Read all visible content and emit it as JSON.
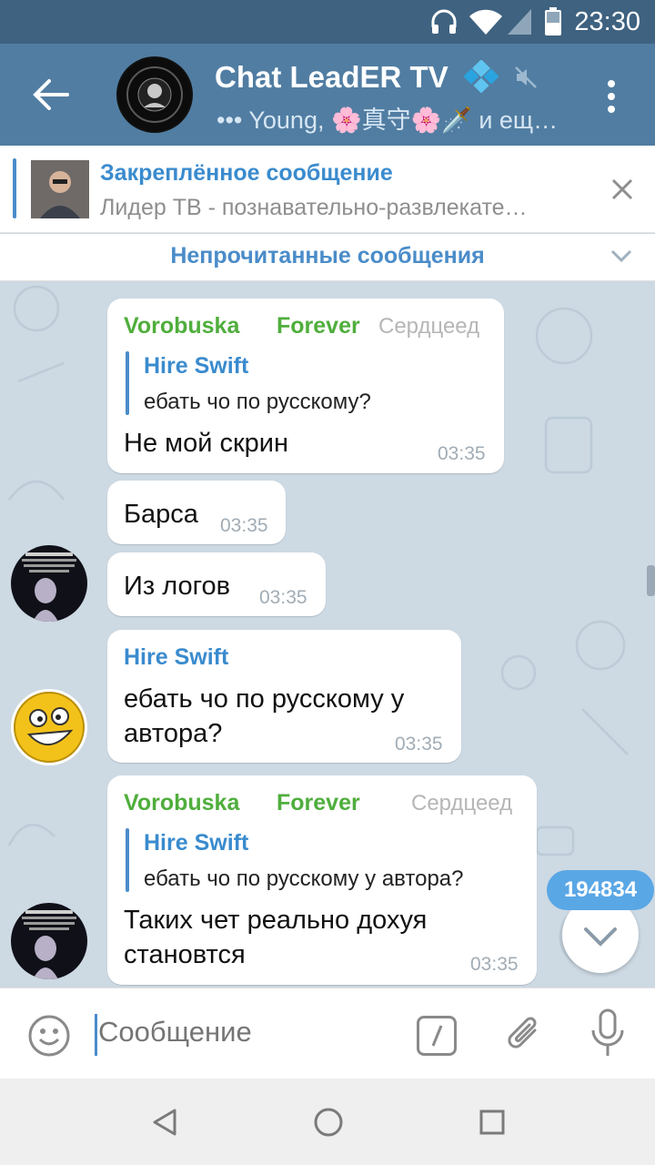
{
  "status_bar": {
    "time": "23:30"
  },
  "header": {
    "title": "Chat LeadER TV",
    "subtitle": "••• Young, 🌸真守🌸🗡️ и ещ…",
    "icons": [
      "back-arrow-icon",
      "diamond-icon",
      "muted-icon",
      "more-vert-icon"
    ]
  },
  "pinned": {
    "title": "Закреплённое сообщение",
    "text": "Лидер ТВ - познавательно-развлекате…"
  },
  "unread_divider": {
    "label": "Непрочитанные сообщения"
  },
  "messages": [
    {
      "author": "Vorobuska",
      "author2": "Forever",
      "rank": "Сердцеед",
      "reply_author": "Hire Swift",
      "reply_text": "ебать чо по русскому?",
      "text": "Не мой скрин",
      "time": "03:35"
    },
    {
      "text": "Барса",
      "time": "03:35"
    },
    {
      "text": "Из логов",
      "time": "03:35"
    },
    {
      "author": "Hire Swift",
      "text_line1": "ебать чо по русскому у",
      "text_line2": "автора?",
      "time": "03:35"
    },
    {
      "author": "Vorobuska",
      "author2": "Forever",
      "rank": "Сердцеед",
      "reply_author": "Hire Swift",
      "reply_text": "ебать чо по русскому у автора?",
      "text_line1": "Таких чет реально дохуя",
      "text_line2": "становтся",
      "time": "03:35"
    }
  ],
  "unread_count": "194834",
  "composer": {
    "placeholder": "Сообщение"
  },
  "colors": {
    "header": "#517da2",
    "statusbar": "#3e6280",
    "accent": "#4a8cc9",
    "author_green": "#4fae3c"
  }
}
